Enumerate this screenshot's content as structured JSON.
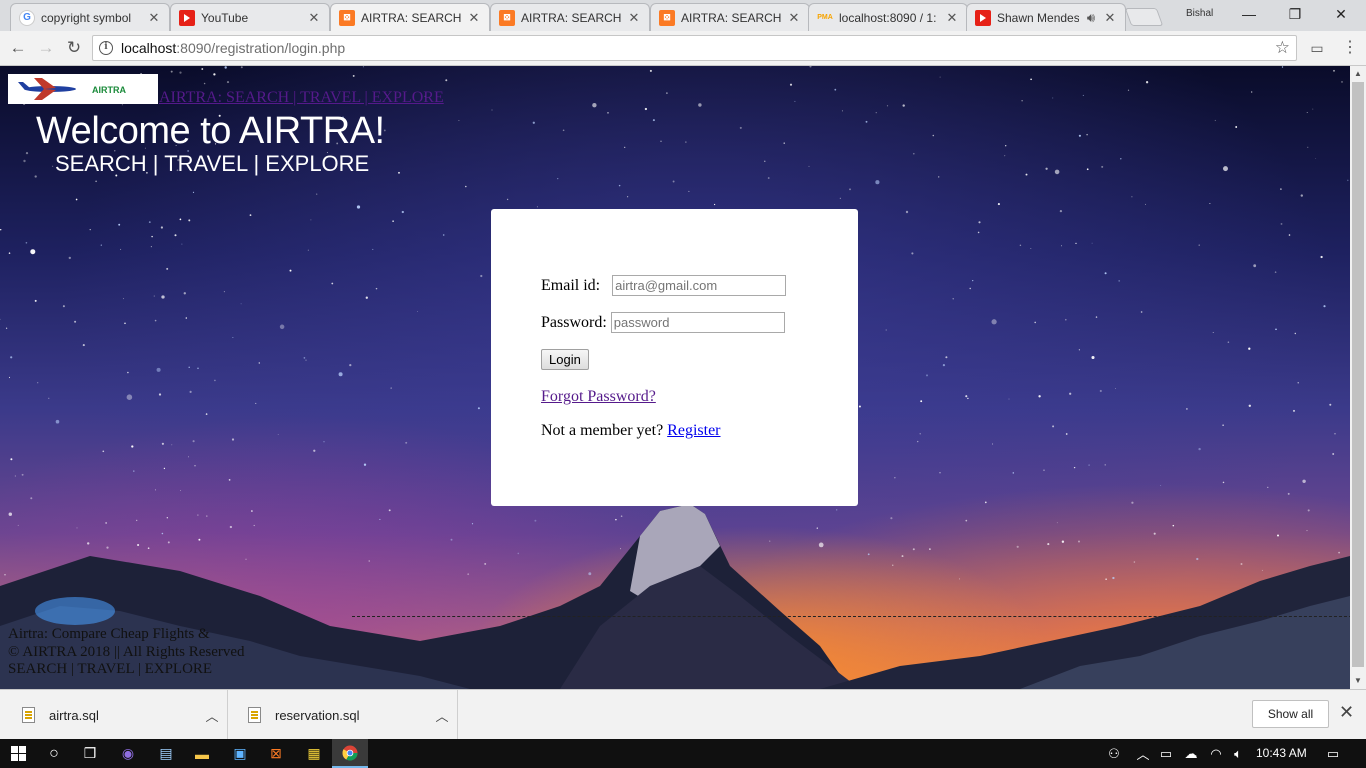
{
  "browser": {
    "tabs": [
      {
        "label": "copyright symbol",
        "icon": "google-icon",
        "active": false
      },
      {
        "label": "YouTube",
        "icon": "youtube-icon",
        "active": false
      },
      {
        "label": "AIRTRA: SEARCH |",
        "icon": "xampp-icon",
        "active": true
      },
      {
        "label": "AIRTRA: SEARCH |",
        "icon": "xampp-icon",
        "active": false
      },
      {
        "label": "AIRTRA: SEARCH |",
        "icon": "xampp-icon",
        "active": false
      },
      {
        "label": "localhost:8090 / 1:",
        "icon": "phpmyadmin-icon",
        "active": false
      },
      {
        "label": "Shawn Mendes",
        "icon": "youtube-icon",
        "active": false
      }
    ],
    "profile_name": "Bishal",
    "url_host": "localhost",
    "url_path": ":8090/registration/login.php"
  },
  "page": {
    "logo_text": "AIRTRA",
    "site_link": "AIRTRA: SEARCH | TRAVEL | EXPLORE",
    "welcome_title": "Welcome to AIRTRA!",
    "welcome_subtitle": "SEARCH | TRAVEL | EXPLORE",
    "login": {
      "email_label": "Email id:",
      "email_placeholder": "airtra@gmail.com",
      "password_label": "Password:",
      "password_placeholder": "password",
      "login_button": "Login",
      "forgot_link": "Forgot Password?",
      "member_text": "Not a member yet?",
      "register_link": "Register"
    },
    "footer": {
      "line1": "Airtra: Compare Cheap Flights &",
      "line2": "© AIRTRA 2018 || All Rights Reserved",
      "line3": "SEARCH | TRAVEL | EXPLORE"
    }
  },
  "downloads": {
    "items": [
      {
        "name": "airtra.sql"
      },
      {
        "name": "reservation.sql"
      }
    ],
    "show_all": "Show all"
  },
  "taskbar": {
    "time": "10:43 AM"
  },
  "colors": {
    "visited_link": "#551a8b",
    "link": "#0000ee",
    "xampp_orange": "#fb7a24",
    "youtube_red": "#e62117"
  }
}
